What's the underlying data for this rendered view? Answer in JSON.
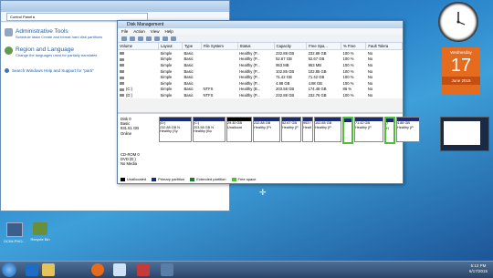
{
  "control_panel": {
    "title": "",
    "address": "Control Panel ▸",
    "categories": [
      {
        "title": "Administrative Tools",
        "subtitle": "Schedule tasks   Create and format hard disk partitions"
      },
      {
        "title": "Region and Language",
        "subtitle": "Change the languages used for partially translated"
      }
    ],
    "help_link": "Search Windows Help and Support for \"parti\""
  },
  "disk_mgmt": {
    "title": "Disk Management",
    "menu": [
      "File",
      "Action",
      "View",
      "Help"
    ],
    "columns": [
      "Volume",
      "Layout",
      "Type",
      "File System",
      "Status",
      "Capacity",
      "Free Spa...",
      "% Free",
      "Fault Tolera"
    ],
    "rows": [
      [
        "",
        "Simple",
        "Basic",
        "",
        "Healthy (P...",
        "232.88 GB",
        "232.88 GB",
        "100 %",
        "No"
      ],
      [
        "",
        "Simple",
        "Basic",
        "",
        "Healthy (P...",
        "52.67 GB",
        "52.67 GB",
        "100 %",
        "No"
      ],
      [
        "",
        "Simple",
        "Basic",
        "",
        "Healthy (P...",
        "953 MB",
        "953 MB",
        "100 %",
        "No"
      ],
      [
        "",
        "Simple",
        "Basic",
        "",
        "Healthy (P...",
        "102.85 GB",
        "102.85 GB",
        "100 %",
        "No"
      ],
      [
        "",
        "Simple",
        "Basic",
        "",
        "Healthy (P...",
        "71.42 GB",
        "71.42 GB",
        "100 %",
        "No"
      ],
      [
        "",
        "Simple",
        "Basic",
        "",
        "Healthy (P...",
        "4.88 GB",
        "4.88 GB",
        "100 %",
        "No"
      ],
      [
        "(C:)",
        "Simple",
        "Basic",
        "NTFS",
        "Healthy (B...",
        "203.58 GB",
        "174.48 GB",
        "86 %",
        "No"
      ],
      [
        "(D:)",
        "Simple",
        "Basic",
        "NTFS",
        "Healthy (P...",
        "232.88 GB",
        "232.76 GB",
        "100 %",
        "No"
      ]
    ],
    "disk0": {
      "label": "Disk 0",
      "type": "Basic",
      "size": "931.51 GB",
      "status": "Online"
    },
    "partitions": [
      {
        "kind": "primary",
        "name": "(D:)",
        "size": "232.88 GB N",
        "status": "Healthy (Sy"
      },
      {
        "kind": "primary",
        "name": "(C:)",
        "size": "203.58 GB N",
        "status": "Healthy (Bo"
      },
      {
        "kind": "unalloc",
        "name": "",
        "size": "29.30 GB",
        "status": "Unallocat"
      },
      {
        "kind": "primary",
        "name": "",
        "size": "232.88 GB",
        "status": "Healthy (Pr"
      },
      {
        "kind": "primary",
        "name": "",
        "size": "52.67 GB",
        "status": "Healthy (P"
      },
      {
        "kind": "primary",
        "name": "",
        "size": "953 I",
        "status": "Healt"
      },
      {
        "kind": "primary",
        "name": "",
        "size": "102.85 GB",
        "status": "Healthy (P"
      },
      {
        "kind": "free",
        "name": "",
        "size": "",
        "status": ""
      },
      {
        "kind": "ext",
        "name": "",
        "size": "71.42 GB",
        "status": "Healthy (P"
      },
      {
        "kind": "free",
        "name": "",
        "size": "7",
        "status": "H"
      },
      {
        "kind": "primary",
        "name": "",
        "size": "4.88 GB",
        "status": "Healthy (P"
      }
    ],
    "cdrom": {
      "label": "CD-ROM 0",
      "type": "DVD (E:)",
      "status": "No Media"
    },
    "legend": [
      {
        "label": "Unallocated",
        "color": "#000000"
      },
      {
        "label": "Primary partition",
        "color": "#1b2a78"
      },
      {
        "label": "Extended partition",
        "color": "#1e7a2e"
      },
      {
        "label": "Free space",
        "color": "#4fbf3a"
      }
    ]
  },
  "calendar": {
    "weekday": "Wednesday",
    "day": "17",
    "month_year": "June 2015"
  },
  "desktop_icons": [
    "DCIM-PHO...",
    "Recycle Bin"
  ],
  "taskbar": {
    "time": "5:12 PM",
    "date": "6/17/2015"
  },
  "colors": {
    "accent": "#2a82c9",
    "calendar": "#e56b1f"
  }
}
